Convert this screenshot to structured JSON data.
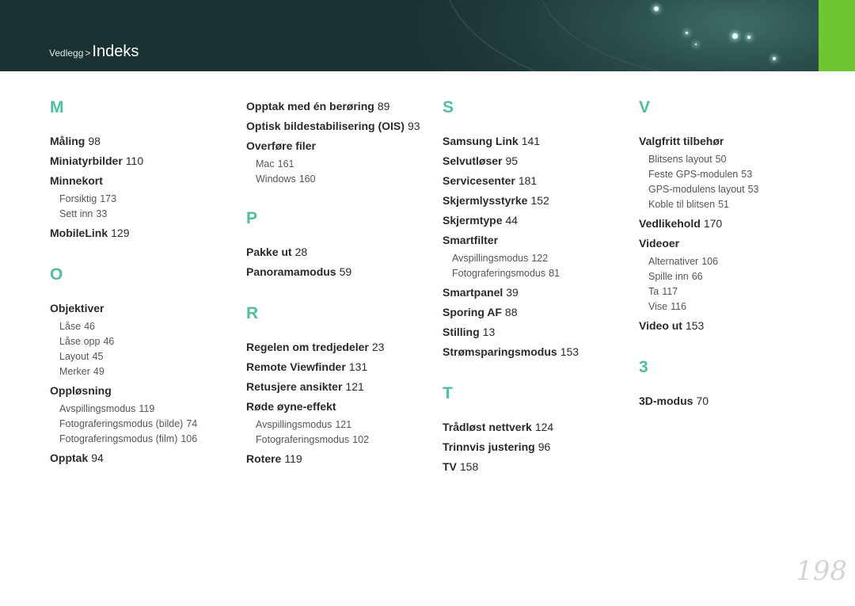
{
  "header": {
    "breadcrumb_parent": "Vedlegg",
    "breadcrumb_separator": ">",
    "breadcrumb_current": "Indeks",
    "accent_color": "#6ec72e",
    "letter_color": "#4fbf9d"
  },
  "columns": [
    {
      "sections": [
        {
          "letter": "M",
          "entries": [
            {
              "term": "Måling",
              "page": "98"
            },
            {
              "term": "Miniatyrbilder",
              "page": "110"
            },
            {
              "term": "Minnekort",
              "page": "",
              "subs": [
                {
                  "term": "Forsiktig",
                  "page": "173"
                },
                {
                  "term": "Sett inn",
                  "page": "33"
                }
              ]
            },
            {
              "term": "MobileLink",
              "page": "129"
            }
          ]
        },
        {
          "letter": "O",
          "entries": [
            {
              "term": "Objektiver",
              "page": "",
              "subs": [
                {
                  "term": "Låse",
                  "page": "46"
                },
                {
                  "term": "Låse opp",
                  "page": "46"
                },
                {
                  "term": "Layout",
                  "page": "45"
                },
                {
                  "term": "Merker",
                  "page": "49"
                }
              ]
            },
            {
              "term": "Oppløsning",
              "page": "",
              "subs": [
                {
                  "term": "Avspillingsmodus",
                  "page": "119"
                },
                {
                  "term": "Fotograferingsmodus (bilde)",
                  "page": "74"
                },
                {
                  "term": "Fotograferingsmodus (film)",
                  "page": "106"
                }
              ]
            },
            {
              "term": "Opptak",
              "page": "94"
            }
          ]
        }
      ]
    },
    {
      "sections": [
        {
          "letter": "",
          "entries": [
            {
              "term": "Opptak med én berøring",
              "page": "89"
            },
            {
              "term": "Optisk bildestabilisering (OIS)",
              "page": "93"
            },
            {
              "term": "Overføre filer",
              "page": "",
              "subs": [
                {
                  "term": "Mac",
                  "page": "161"
                },
                {
                  "term": "Windows",
                  "page": "160"
                }
              ]
            }
          ]
        },
        {
          "letter": "P",
          "entries": [
            {
              "term": "Pakke ut",
              "page": "28"
            },
            {
              "term": "Panoramamodus",
              "page": "59"
            }
          ]
        },
        {
          "letter": "R",
          "entries": [
            {
              "term": "Regelen om tredjedeler",
              "page": "23"
            },
            {
              "term": "Remote Viewfinder",
              "page": "131"
            },
            {
              "term": "Retusjere ansikter",
              "page": "121"
            },
            {
              "term": "Røde øyne-effekt",
              "page": "",
              "subs": [
                {
                  "term": "Avspillingsmodus",
                  "page": "121"
                },
                {
                  "term": "Fotograferingsmodus",
                  "page": "102"
                }
              ]
            },
            {
              "term": "Rotere",
              "page": "119"
            }
          ]
        }
      ]
    },
    {
      "sections": [
        {
          "letter": "S",
          "entries": [
            {
              "term": "Samsung Link",
              "page": "141"
            },
            {
              "term": "Selvutløser",
              "page": "95"
            },
            {
              "term": "Servicesenter",
              "page": "181"
            },
            {
              "term": "Skjermlysstyrke",
              "page": "152"
            },
            {
              "term": "Skjermtype",
              "page": "44"
            },
            {
              "term": "Smartfilter",
              "page": "",
              "subs": [
                {
                  "term": "Avspillingsmodus",
                  "page": "122"
                },
                {
                  "term": "Fotograferingsmodus",
                  "page": "81"
                }
              ]
            },
            {
              "term": "Smartpanel",
              "page": "39"
            },
            {
              "term": "Sporing AF",
              "page": "88"
            },
            {
              "term": "Stilling",
              "page": "13"
            },
            {
              "term": "Strømsparingsmodus",
              "page": "153"
            }
          ]
        },
        {
          "letter": "T",
          "entries": [
            {
              "term": "Trådløst nettverk",
              "page": "124"
            },
            {
              "term": "Trinnvis justering",
              "page": "96"
            },
            {
              "term": "TV",
              "page": "158"
            }
          ]
        }
      ]
    },
    {
      "sections": [
        {
          "letter": "V",
          "entries": [
            {
              "term": "Valgfritt tilbehør",
              "page": "",
              "subs": [
                {
                  "term": "Blitsens layout",
                  "page": "50"
                },
                {
                  "term": "Feste GPS-modulen",
                  "page": "53"
                },
                {
                  "term": "GPS-modulens layout",
                  "page": "53"
                },
                {
                  "term": "Koble til blitsen",
                  "page": "51"
                }
              ]
            },
            {
              "term": "Vedlikehold",
              "page": "170"
            },
            {
              "term": "Videoer",
              "page": "",
              "subs": [
                {
                  "term": "Alternativer",
                  "page": "106"
                },
                {
                  "term": "Spille inn",
                  "page": "66"
                },
                {
                  "term": "Ta",
                  "page": "117"
                },
                {
                  "term": "Vise",
                  "page": "116"
                }
              ]
            },
            {
              "term": "Video ut",
              "page": "153"
            }
          ]
        },
        {
          "letter": "3",
          "entries": [
            {
              "term": "3D-modus",
              "page": "70"
            }
          ]
        }
      ]
    }
  ],
  "page_number": "198"
}
